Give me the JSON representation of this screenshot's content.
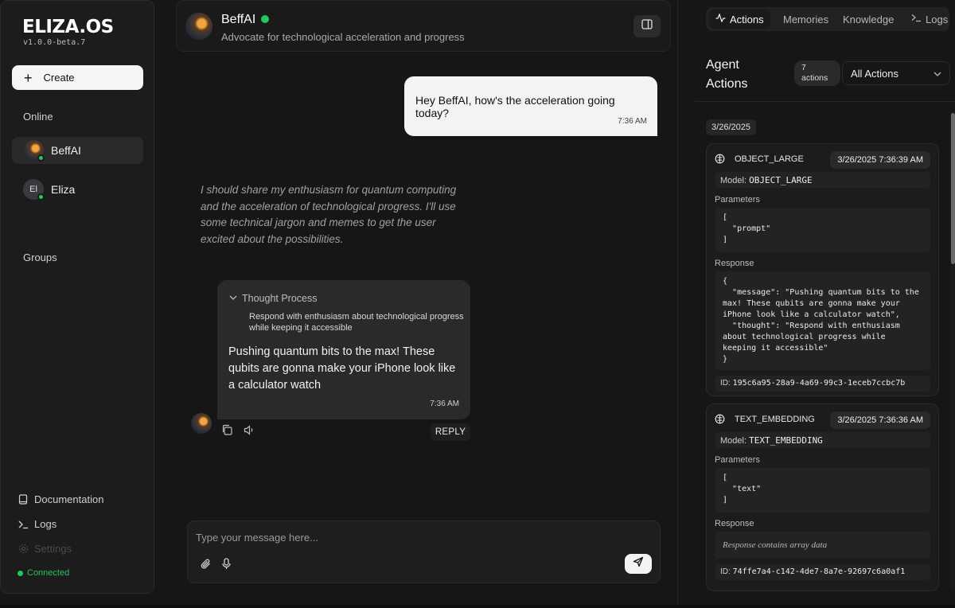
{
  "sidebar": {
    "logo": "ELIZA.OS",
    "version": "v1.0.0-beta.7",
    "create_label": "Create",
    "online_label": "Online",
    "groups_label": "Groups",
    "agents": [
      {
        "name": "BeffAI",
        "initials": ""
      },
      {
        "name": "Eliza",
        "initials": "El"
      }
    ],
    "links": {
      "documentation": "Documentation",
      "logs": "Logs",
      "settings": "Settings"
    },
    "status": "Connected"
  },
  "chat": {
    "agent_name": "BeffAI",
    "agent_bio": "Advocate for technological acceleration and progress",
    "user_message": {
      "text": "Hey BeffAI, how's the acceleration going today?",
      "time": "7:36 AM"
    },
    "thought_text": "I should share my enthusiasm for quantum computing and the acceleration of technological progress. I'll use some technical jargon and memes to get the user excited about the possibilities.",
    "agent_message": {
      "thought_label": "Thought Process",
      "thought_body": "Respond with enthusiasm about technological progress while keeping it accessible",
      "text": "Pushing quantum bits to the max! These qubits are gonna make your iPhone look like a calculator watch",
      "time": "7:36 AM"
    },
    "reply_label": "REPLY",
    "input_placeholder": "Type your message here..."
  },
  "panel": {
    "tabs": [
      "Actions",
      "Memories",
      "Knowledge",
      "Logs"
    ],
    "title": "Agent Actions",
    "count": "7 actions",
    "filter": "All Actions",
    "date": "3/26/2025",
    "cards": [
      {
        "type": "OBJECT_LARGE",
        "time": "3/26/2025 7:36:39 AM",
        "model_label": "Model:",
        "model": "OBJECT_LARGE",
        "params_label": "Parameters",
        "params": "[\n  \"prompt\"\n]",
        "response_label": "Response",
        "response": "{\n  \"message\": \"Pushing quantum bits to the max! These qubits are gonna make your iPhone look like a calculator watch\",\n  \"thought\": \"Respond with enthusiasm about technological progress while keeping it accessible\"\n}",
        "id_label": "ID:",
        "id": "195c6a95-28a9-4a69-99c3-1eceb7ccbc7b"
      },
      {
        "type": "TEXT_EMBEDDING",
        "time": "3/26/2025 7:36:36 AM",
        "model_label": "Model:",
        "model": "TEXT_EMBEDDING",
        "params_label": "Parameters",
        "params": "[\n  \"text\"\n]",
        "response_label": "Response",
        "response": "Response contains array data",
        "id_label": "ID:",
        "id": "74ffe7a4-c142-4de7-8a7e-92697c6a0af1"
      }
    ]
  },
  "colors": {
    "online": "#22c55e",
    "background": "#161616"
  }
}
